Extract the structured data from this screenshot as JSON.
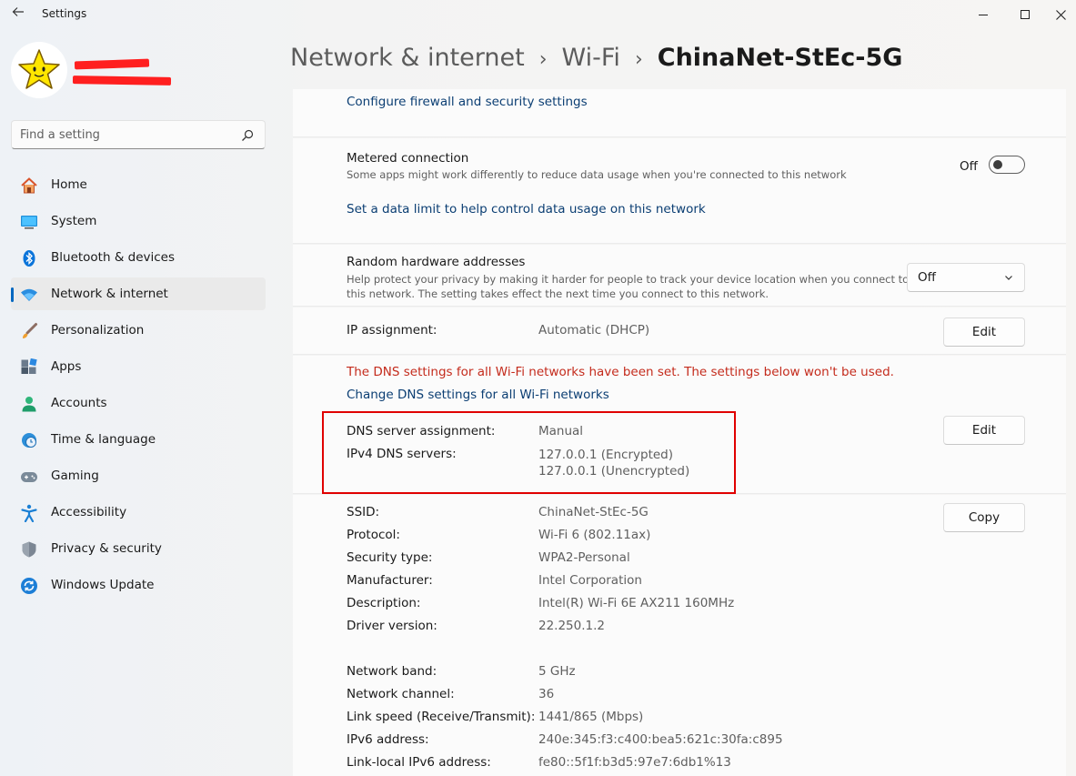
{
  "window": {
    "title": "Settings"
  },
  "search": {
    "placeholder": "Find a setting"
  },
  "sidebar": {
    "items": [
      {
        "label": "Home"
      },
      {
        "label": "System"
      },
      {
        "label": "Bluetooth & devices"
      },
      {
        "label": "Network & internet"
      },
      {
        "label": "Personalization"
      },
      {
        "label": "Apps"
      },
      {
        "label": "Accounts"
      },
      {
        "label": "Time & language"
      },
      {
        "label": "Gaming"
      },
      {
        "label": "Accessibility"
      },
      {
        "label": "Privacy & security"
      },
      {
        "label": "Windows Update"
      }
    ]
  },
  "breadcrumb": {
    "root": "Network & internet",
    "middle": "Wi-Fi",
    "current": "ChinaNet-StEc-5G"
  },
  "firewall": {
    "link": "Configure firewall and security settings"
  },
  "metered": {
    "title": "Metered connection",
    "description": "Some apps might work differently to reduce data usage when you're connected to this network",
    "toggle_label": "Off",
    "toggle_on": false,
    "data_limit_link": "Set a data limit to help control data usage on this network"
  },
  "random_hw": {
    "title": "Random hardware addresses",
    "description_line1": "Help protect your privacy by making it harder for people to track your device location when you connect to",
    "description_line2": "this network. The setting takes effect the next time you connect to this network.",
    "dropdown_value": "Off"
  },
  "ip": {
    "label": "IP assignment:",
    "value": "Automatic (DHCP)",
    "edit_label": "Edit"
  },
  "dns": {
    "warning": "The DNS settings for all Wi-Fi networks have been set. The settings below won't be used.",
    "change_link": "Change DNS settings for all Wi-Fi networks",
    "assignment_label": "DNS server assignment:",
    "assignment_value": "Manual",
    "ipv4_label": "IPv4 DNS servers:",
    "ipv4_value1": "127.0.0.1 (Encrypted)",
    "ipv4_value2": "127.0.0.1 (Unencrypted)",
    "edit_label": "Edit"
  },
  "properties": {
    "copy_label": "Copy",
    "rows": [
      {
        "label": "SSID:",
        "value": "ChinaNet-StEc-5G"
      },
      {
        "label": "Protocol:",
        "value": "Wi-Fi 6 (802.11ax)"
      },
      {
        "label": "Security type:",
        "value": "WPA2-Personal"
      },
      {
        "label": "Manufacturer:",
        "value": "Intel Corporation"
      },
      {
        "label": "Description:",
        "value": "Intel(R) Wi-Fi 6E AX211 160MHz"
      },
      {
        "label": "Driver version:",
        "value": "22.250.1.2"
      },
      {
        "label": "Network band:",
        "value": "5 GHz"
      },
      {
        "label": "Network channel:",
        "value": "36"
      },
      {
        "label": "Link speed (Receive/Transmit):",
        "value": "1441/865 (Mbps)"
      },
      {
        "label": "IPv6 address:",
        "value": "240e:345:f3:c400:bea5:621c:30fa:c895"
      },
      {
        "label": "Link-local IPv6 address:",
        "value": "fe80::5f1f:b3d5:97e7:6db1%13"
      }
    ]
  },
  "colors": {
    "accent": "#0067c0",
    "link": "#0b3e73",
    "warning": "#c42b1c",
    "highlight_box": "#e00000"
  }
}
